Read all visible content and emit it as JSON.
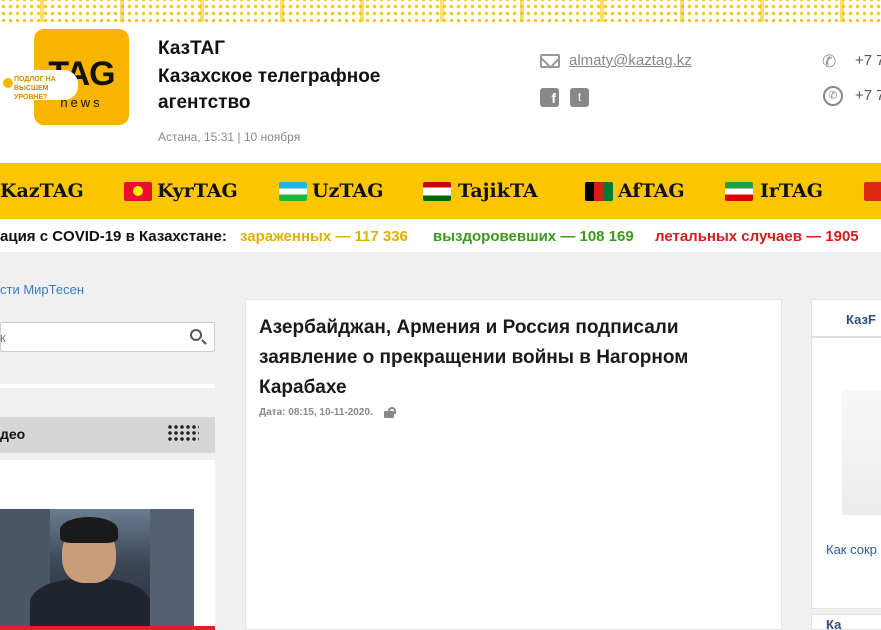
{
  "header": {
    "logo_main": "TAG",
    "logo_sub": "news",
    "site_name": "КазТАГ",
    "site_desc": "Казахское телеграфное агентство",
    "datetime": "Астана, 15:31 | 10 ноября",
    "email": "almaty@kaztag.kz",
    "phone1": "+7 7",
    "phone2": "+7 7",
    "fb_glyph": "f",
    "tw_glyph": "t",
    "phone_glyph": "✆",
    "wa_glyph": "✆"
  },
  "nav": {
    "items": [
      {
        "label": "KazTAG",
        "flag": "kz"
      },
      {
        "label": "KyrTAG",
        "flag": "kg"
      },
      {
        "label": "UzTAG",
        "flag": "uz"
      },
      {
        "label": "TajikTA",
        "flag": "tj"
      },
      {
        "label": "AfTAG",
        "flag": "af"
      },
      {
        "label": "IrTAG",
        "flag": "ir"
      }
    ]
  },
  "ticker": {
    "prefix": "ация с COVID-19 в Казахстане:",
    "infected": "зараженных — 117 336",
    "recovered": "выздоровевших — 108 169",
    "deaths": "летальных случаев — 1905",
    "colors": {
      "infected": "#e0b000",
      "recovered": "#3a9a1a",
      "deaths": "#d81b1b"
    }
  },
  "sidebar": {
    "miretesen": "сти МирТесен",
    "search_placeholder": "к",
    "video_title": "део",
    "thumb_badge": "ПОДЛОГ НА ВЫСШЕМ УРОВНЕ?"
  },
  "article": {
    "title": "Азербайджан, Армения и Россия подписали заявление о прекращении войны в Нагорном Карабахе",
    "date": "Дата: 08:15, 10-11-2020."
  },
  "right": {
    "tab": "КазF",
    "link": "Как сокр банке?",
    "bottom": "Ка"
  },
  "colors": {
    "accent": "#fbc600",
    "logo": "#f7b500",
    "link": "#2b5a9a"
  }
}
